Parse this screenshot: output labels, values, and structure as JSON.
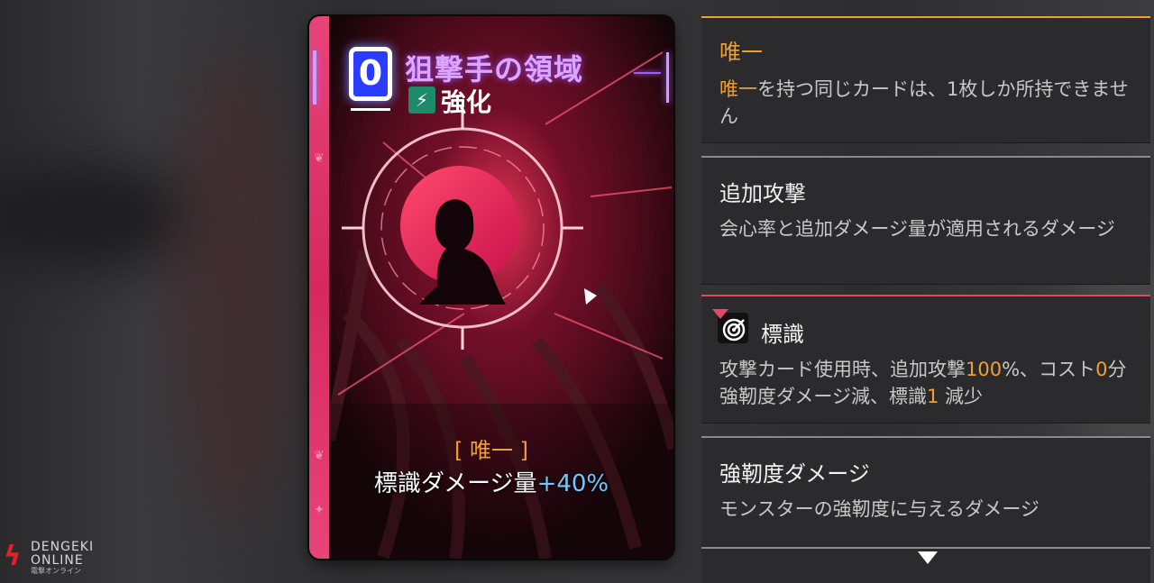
{
  "card": {
    "cost": "0",
    "title": "狙撃手の領域",
    "type_icon": "lightning-icon",
    "type": "強化",
    "tag": "[ 唯一 ]",
    "effect_label": "標識ダメージ量",
    "effect_value": "+40%",
    "colors": {
      "stripe": "#e8447a",
      "title": "#dca6ff",
      "tag": "#f0a030",
      "value": "#6cc8ff"
    }
  },
  "panels": [
    {
      "title": "唯一",
      "desc_highlight": "唯一",
      "desc_rest": "を持つ同じカードは、1枚しか所持できません",
      "accent": "#f0a030"
    },
    {
      "title": "追加攻撃",
      "desc": "会心率と追加ダメージ量が適用されるダメージ"
    },
    {
      "icon": "target-icon",
      "title": "標識",
      "desc_parts": [
        "攻撃カード使用時、追加攻撃",
        "100",
        "%、コスト",
        "0",
        "分強靭度ダメージ減、標識",
        "1",
        " 減少"
      ],
      "accent": "#d84a5c"
    },
    {
      "title": "強靭度ダメージ",
      "desc": "モンスターの強靭度に与えるダメージ"
    }
  ],
  "watermark": {
    "line1": "DENGEKI",
    "line2": "ONLINE",
    "sub": "電撃オンライン"
  }
}
